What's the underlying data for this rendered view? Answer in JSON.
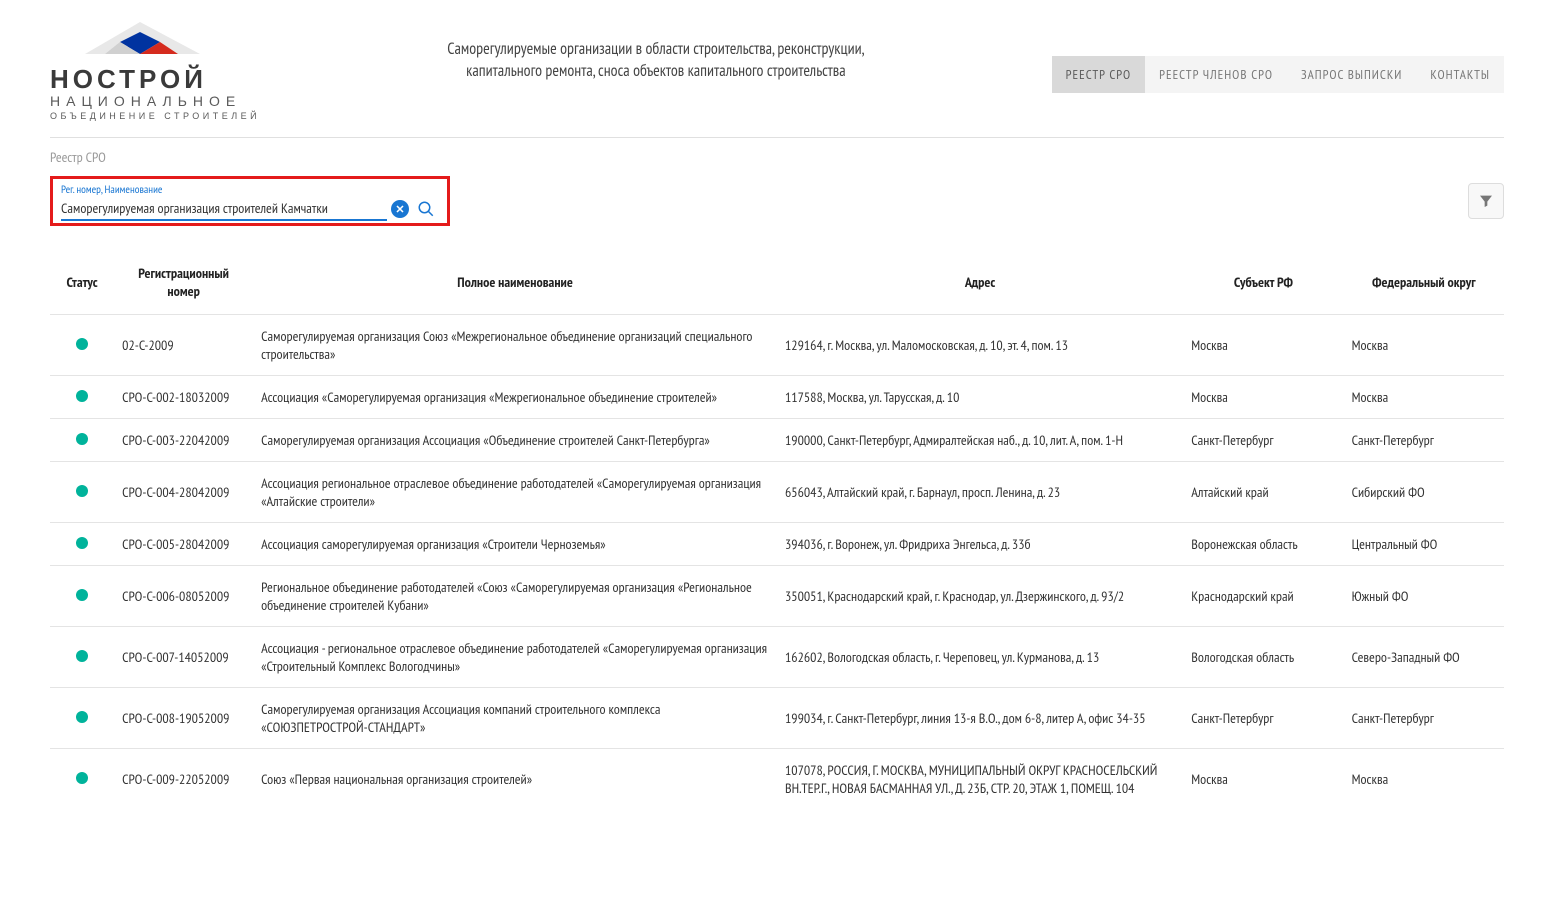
{
  "logo": {
    "main": "НОСТРОЙ",
    "sub1": "НАЦИОНАЛЬНОЕ",
    "sub2": "ОБЪЕДИНЕНИЕ СТРОИТЕЛЕЙ"
  },
  "header_tagline_l1": "Саморегулируемые организации в области строительства, реконструкции,",
  "header_tagline_l2": "капитального ремонта, сноса объектов капитального строительства",
  "nav": {
    "sro": "РЕЕСТР СРО",
    "members": "РЕЕСТР ЧЛЕНОВ СРО",
    "extract": "ЗАПРОС ВЫПИСКИ",
    "contacts": "КОНТАКТЫ"
  },
  "breadcrumb": "Реестр СРО",
  "search": {
    "label": "Рег. номер, Наименование",
    "value": "Саморегулируемая организация строителей Камчатки"
  },
  "columns": {
    "status": "Статус",
    "reg": "Регистрационный номер",
    "name": "Полное наименование",
    "addr": "Адрес",
    "subj": "Субъект РФ",
    "dist": "Федеральный округ"
  },
  "rows": [
    {
      "reg": "02-С-2009",
      "name": "Саморегулируемая организация Союз «Межрегиональное объединение организаций специального строительства»",
      "addr": "129164, г. Москва, ул. Маломосковская, д. 10, эт. 4, пом. 13",
      "subj": "Москва",
      "dist": "Москва"
    },
    {
      "reg": "СРО-С-002-18032009",
      "name": "Ассоциация «Саморегулируемая организация «Межрегиональное объединение строителей»",
      "addr": "117588, Москва, ул. Тарусская, д. 10",
      "subj": "Москва",
      "dist": "Москва"
    },
    {
      "reg": "СРО-С-003-22042009",
      "name": "Саморегулируемая организация Ассоциация «Объединение строителей Санкт-Петербурга»",
      "addr": "190000, Санкт-Петербург, Адмиралтейская наб., д. 10, лит. А, пом. 1-Н",
      "subj": "Санкт-Петербург",
      "dist": "Санкт-Петербург"
    },
    {
      "reg": "СРО-С-004-28042009",
      "name": "Ассоциация региональное отраслевое объединение работодателей «Саморегулируемая организация «Алтайские строители»",
      "addr": "656043, Алтайский край, г. Барнаул, просп. Ленина, д. 23",
      "subj": "Алтайский край",
      "dist": "Сибирский ФО"
    },
    {
      "reg": "СРО-С-005-28042009",
      "name": "Ассоциация саморегулируемая организация «Строители Черноземья»",
      "addr": "394036, г. Воронеж, ул. Фридриха Энгельса, д. 33б",
      "subj": "Воронежская область",
      "dist": "Центральный ФО"
    },
    {
      "reg": "СРО-С-006-08052009",
      "name": "Региональное объединение работодателей «Союз «Саморегулируемая организация «Региональное объединение строителей Кубани»",
      "addr": "350051, Краснодарский край, г. Краснодар, ул. Дзержинского, д. 93/2",
      "subj": "Краснодарский край",
      "dist": "Южный ФО"
    },
    {
      "reg": "СРО-С-007-14052009",
      "name": "Ассоциация - региональное отраслевое объединение работодателей «Саморегулируемая организация «Строительный Комплекс Вологодчины»",
      "addr": "162602, Вологодская область, г. Череповец, ул. Курманова, д. 13",
      "subj": "Вологодская область",
      "dist": "Северо-Западный ФО"
    },
    {
      "reg": "СРО-С-008-19052009",
      "name": "Саморегулируемая организация Ассоциация компаний строительного комплекса «СОЮЗПЕТРОСТРОЙ-СТАНДАРТ»",
      "addr": "199034, г. Санкт-Петербург, линия 13-я В.О., дом 6-8, литер А, офис 34-35",
      "subj": "Санкт-Петербург",
      "dist": "Санкт-Петербург"
    },
    {
      "reg": "СРО-С-009-22052009",
      "name": "Союз «Первая национальная организация строителей»",
      "addr": "107078, РОССИЯ, Г. МОСКВА, МУНИЦИПАЛЬНЫЙ ОКРУГ КРАСНОСЕЛЬСКИЙ ВН.ТЕР.Г., НОВАЯ БАСМАННАЯ УЛ., Д. 23Б, СТР. 20, ЭТАЖ 1, ПОМЕЩ. 104",
      "subj": "Москва",
      "dist": "Москва"
    }
  ]
}
